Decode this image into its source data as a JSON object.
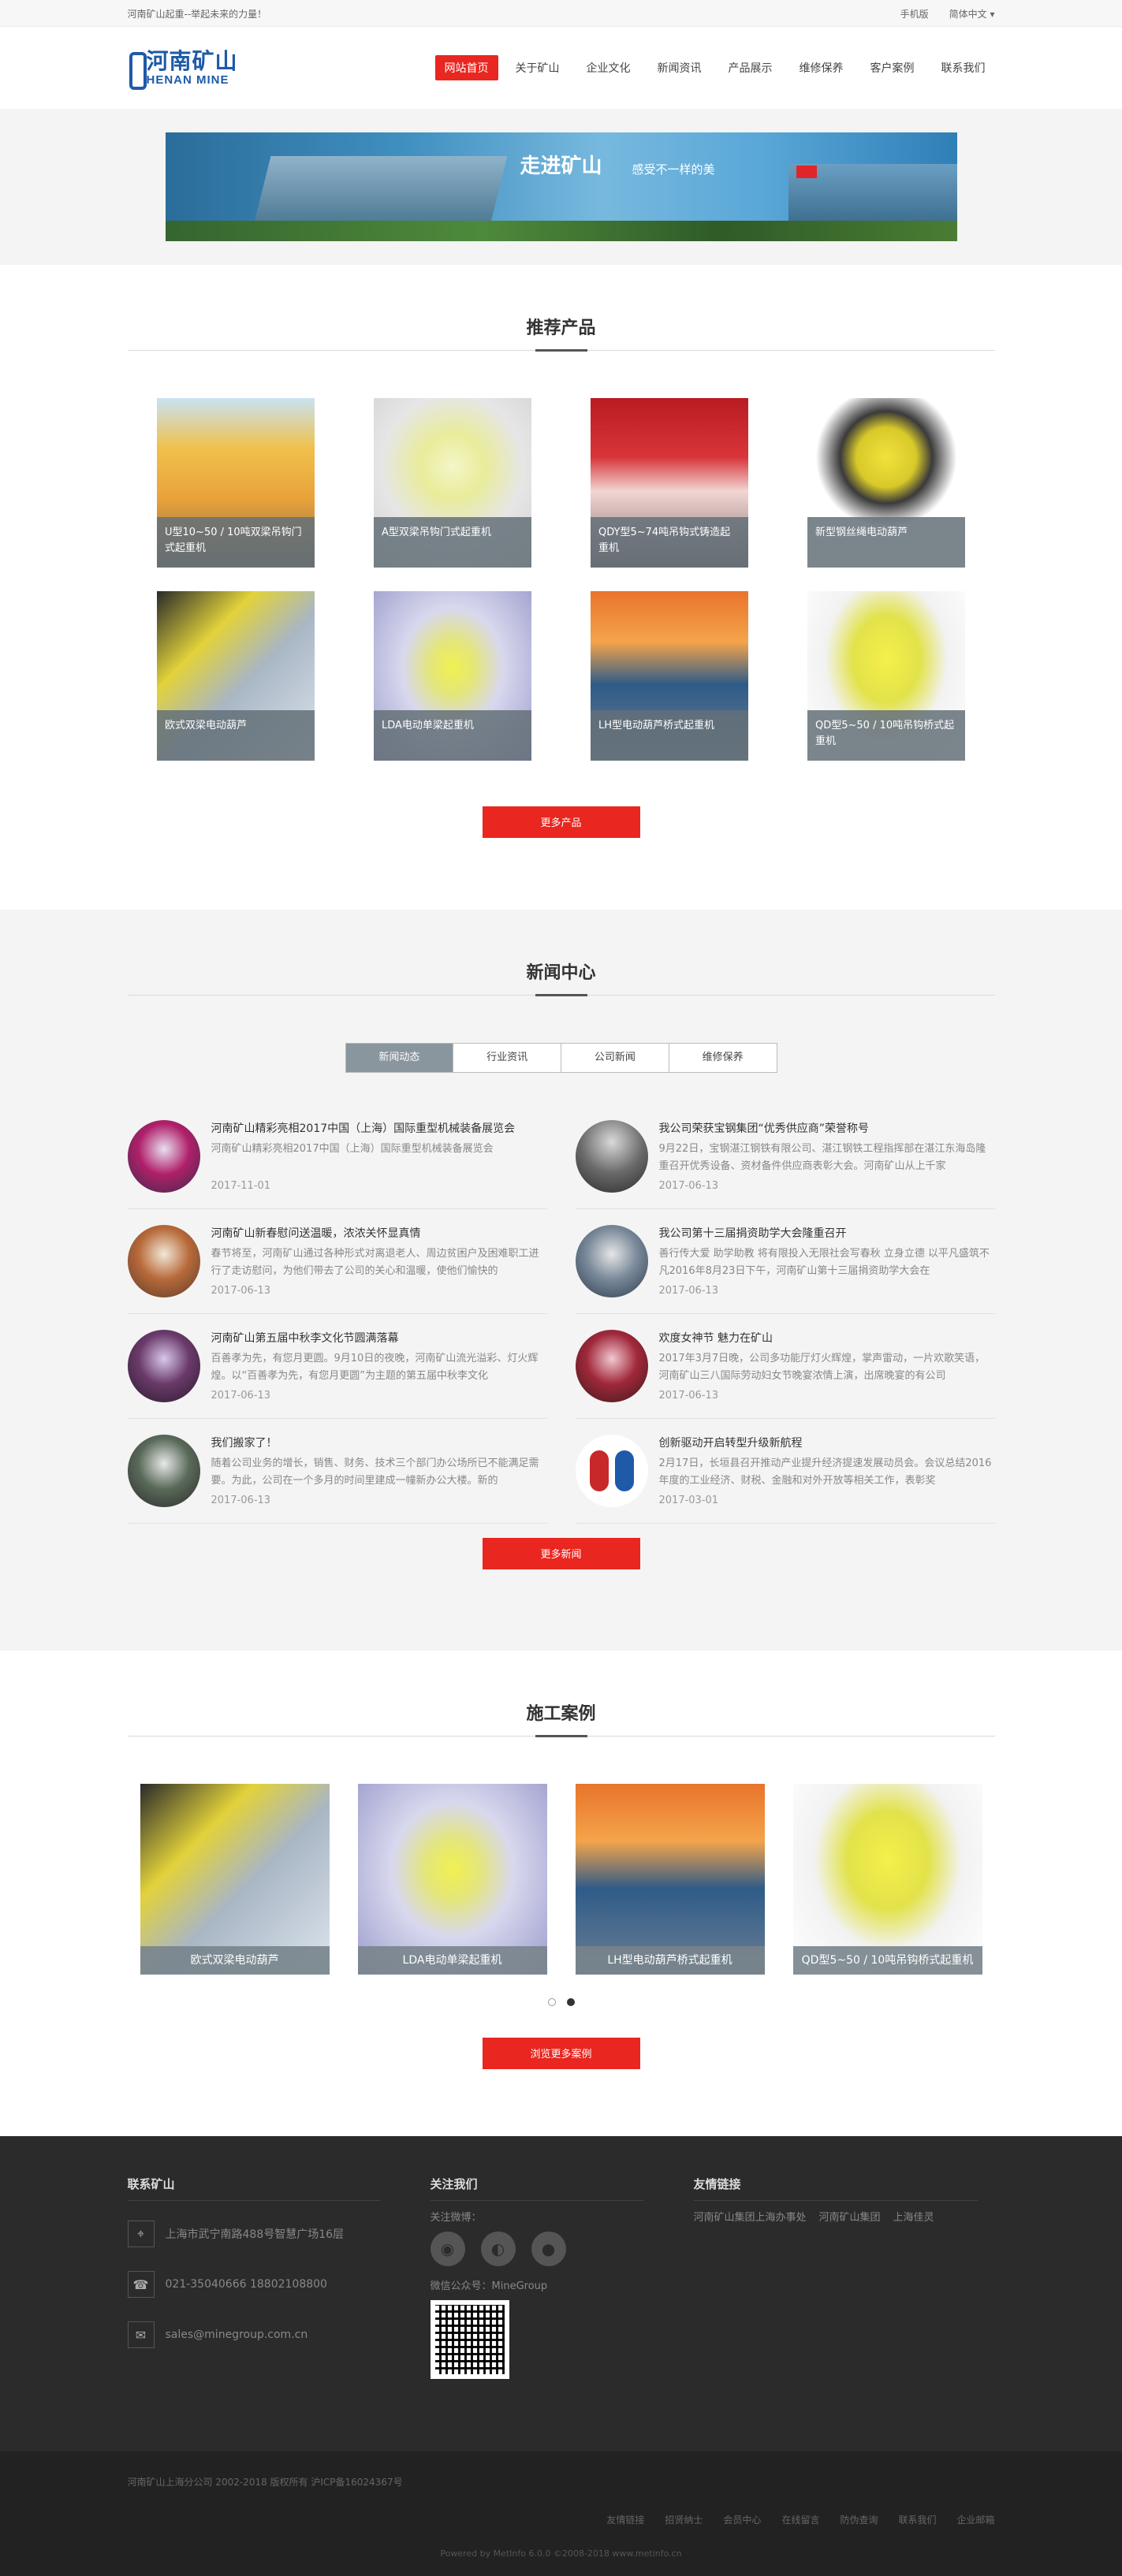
{
  "topbar": {
    "slogan": "河南矿山起重--举起未来的力量！",
    "mobile": "手机版",
    "lang": "简体中文 ▾"
  },
  "header": {
    "logo_cn": "河南矿山",
    "logo_en": "HENAN MINE",
    "nav": [
      "网站首页",
      "关于矿山",
      "企业文化",
      "新闻资讯",
      "产品展示",
      "维修保养",
      "客户案例",
      "联系我们"
    ]
  },
  "banner": {
    "slogan": "走进矿山",
    "sub": "感受不一样的美"
  },
  "products": {
    "title": "推荐产品",
    "items": [
      "U型10~50 / 10吨双梁吊钩门式起重机",
      "A型双梁吊钩门式起重机",
      "QDY型5~74吨吊钩式铸造起重机",
      "新型钢丝绳电动葫芦",
      "欧式双梁电动葫芦",
      "LDA电动单梁起重机",
      "LH型电动葫芦桥式起重机",
      "QD型5~50 / 10吨吊钩桥式起重机"
    ],
    "more": "更多产品"
  },
  "news": {
    "title": "新闻中心",
    "tabs": [
      "新闻动态",
      "行业资讯",
      "公司新闻",
      "维修保养"
    ],
    "items": [
      {
        "title": "河南矿山精彩亮相2017中国（上海）国际重型机械装备展览会",
        "desc": "河南矿山精彩亮相2017中国（上海）国际重型机械装备展览会",
        "date": "2017-11-01"
      },
      {
        "title": "我公司荣获宝钢集团“优秀供应商”荣誉称号",
        "desc": "9月22日，宝钢湛江钢铁有限公司、湛江钢铁工程指挥部在湛江东海岛隆重召开优秀设备、资材备件供应商表彰大会。河南矿山从上千家",
        "date": "2017-06-13"
      },
      {
        "title": "河南矿山新春慰问送温暖，浓浓关怀显真情",
        "desc": "春节将至，河南矿山通过各种形式对离退老人、周边贫困户及困难职工进行了走访慰问，为他们带去了公司的关心和温暖，使他们愉快的",
        "date": "2017-06-13"
      },
      {
        "title": "我公司第十三届捐资助学大会隆重召开",
        "desc": "善行传大爱 助学助教 将有限投入无限社会写春秋 立身立德 以平凡盛筑不凡2016年8月23日下午，河南矿山第十三届捐资助学大会在",
        "date": "2017-06-13"
      },
      {
        "title": "河南矿山第五届中秋李文化节圆满落幕",
        "desc": "百善孝为先，有您月更圆。9月10日的夜晚，河南矿山流光溢彩、灯火辉煌。以“百善孝为先，有您月更圆”为主题的第五届中秋李文化",
        "date": "2017-06-13"
      },
      {
        "title": "欢度女神节 魅力在矿山",
        "desc": "2017年3月7日晚，公司多功能厅灯火辉煌，掌声雷动，一片欢歌笑语，河南矿山三八国际劳动妇女节晚宴浓情上演，出席晚宴的有公司",
        "date": "2017-06-13"
      },
      {
        "title": "我们搬家了！",
        "desc": "随着公司业务的增长，销售、财务、技术三个部门办公场所已不能满足需要。为此，公司在一个多月的时间里建成一幢新办公大楼。新的",
        "date": "2017-06-13"
      },
      {
        "title": "创新驱动开启转型升级新航程",
        "desc": "2月17日，长垣县召开推动产业提升经济提速发展动员会。会议总结2016年度的工业经济、财税、金融和对外开放等相关工作，表彰奖",
        "date": "2017-03-01"
      }
    ],
    "more": "更多新闻"
  },
  "cases": {
    "title": "施工案例",
    "items": [
      "欧式双梁电动葫芦",
      "LDA电动单梁起重机",
      "LH型电动葫芦桥式起重机",
      "QD型5~50 / 10吨吊钩桥式起重机"
    ],
    "more": "浏览更多案例"
  },
  "footer": {
    "contact_title": "联系矿山",
    "address": "上海市武宁南路488号智慧广场16层",
    "phone": "021-35040666 18802108800",
    "email": "sales@minegroup.com.cn",
    "follow_title": "关注我们",
    "follow_label": "关注微博：",
    "wechat": "微信公众号：MineGroup",
    "links_title": "友情链接",
    "links": [
      "河南矿山集团上海办事处",
      "河南矿山集团",
      "上海佳灵"
    ]
  },
  "copyright": {
    "text": "河南矿山上海分公司 2002-2018 版权所有 沪ICP备16024367号",
    "links": [
      "友情链接",
      "招贤纳士",
      "会员中心",
      "在线留言",
      "防伪查询",
      "联系我们",
      "企业邮箱"
    ],
    "powered": "Powered by MetInfo 6.0.0 ©2008-2018  www.metinfo.cn"
  }
}
